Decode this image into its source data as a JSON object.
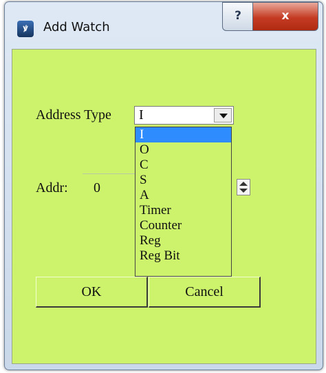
{
  "window": {
    "title": "Add Watch",
    "help_label": "?",
    "close_label": "x"
  },
  "form": {
    "address_type_label": "Address Type",
    "address_type_value": "I",
    "addr_label": "Addr:",
    "addr_value": "0"
  },
  "dropdown": {
    "items": [
      "I",
      "O",
      "C",
      "S",
      "A",
      "Timer",
      "Counter",
      "Reg",
      "Reg Bit"
    ],
    "selected_index": 0
  },
  "buttons": {
    "ok_label": "OK",
    "cancel_label": "Cancel"
  },
  "colors": {
    "client_bg": "#ccf36b",
    "selection": "#2f8cff",
    "close_button": "#c43b22"
  }
}
